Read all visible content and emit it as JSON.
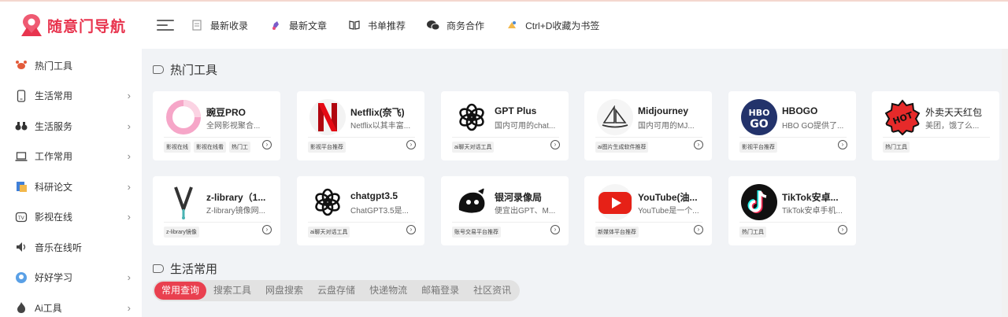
{
  "brand": {
    "name": "随意门导航",
    "color": "#e8344e"
  },
  "nav": [
    {
      "label": "最新收录",
      "icon": "document-icon"
    },
    {
      "label": "最新文章",
      "icon": "pen-icon"
    },
    {
      "label": "书单推荐",
      "icon": "book-icon"
    },
    {
      "label": "商务合作",
      "icon": "wechat-icon"
    },
    {
      "label": "Ctrl+D收藏为书签",
      "icon": "bookmark-icon"
    }
  ],
  "sidebar": [
    {
      "label": "热门工具",
      "icon": "crab-icon",
      "arrow": ""
    },
    {
      "label": "生活常用",
      "icon": "phone-icon",
      "arrow": "›"
    },
    {
      "label": "生活服务",
      "icon": "binoculars-icon",
      "arrow": "›"
    },
    {
      "label": "工作常用",
      "icon": "laptop-icon",
      "arrow": "›"
    },
    {
      "label": "科研论文",
      "icon": "paper-icon",
      "arrow": "›"
    },
    {
      "label": "影视在线",
      "icon": "tv-icon",
      "arrow": "›"
    },
    {
      "label": "音乐在线听",
      "icon": "speaker-icon",
      "arrow": ""
    },
    {
      "label": "好好学习",
      "icon": "study-icon",
      "arrow": "›"
    },
    {
      "label": "Ai工具",
      "icon": "fire-icon",
      "arrow": "›"
    }
  ],
  "sections": [
    {
      "title": "热门工具"
    },
    {
      "title": "生活常用"
    }
  ],
  "cards": [
    {
      "title": "豌豆PRO",
      "desc": "全网影视聚合...",
      "tags": [
        "影视在线",
        "影视在线看",
        "热门工"
      ],
      "icon": "wandou-pro-icon"
    },
    {
      "title": "Netflix(奈飞)",
      "desc": "Netflix以其丰富...",
      "tags": [
        "影视平台推荐"
      ],
      "icon": "netflix-icon"
    },
    {
      "title": "GPT Plus",
      "desc": "国内可用的chat...",
      "tags": [
        "ai聊天对话工具"
      ],
      "icon": "openai-icon"
    },
    {
      "title": "Midjourney",
      "desc": "国内可用的MJ...",
      "tags": [
        "ai图片生成软件推荐"
      ],
      "icon": "midjourney-icon"
    },
    {
      "title": "HBOGO",
      "desc": "HBO GO提供了...",
      "tags": [
        "影视平台推荐"
      ],
      "icon": "hbogo-icon"
    },
    {
      "title": "外卖天天红包",
      "desc": "美团，饿了么...",
      "tags": [
        "热门工具"
      ],
      "icon": "hot-badge-icon"
    },
    {
      "title": "z-library（1...",
      "desc": "Z-library镜像网...",
      "tags": [
        "z-library镜像"
      ],
      "icon": "zlibrary-icon"
    },
    {
      "title": "chatgpt3.5",
      "desc": "ChatGPT3.5是...",
      "tags": [
        "ai聊天对话工具"
      ],
      "icon": "openai-icon"
    },
    {
      "title": "银河录像局",
      "desc": "便宜出GPT、M...",
      "tags": [
        "账号交易平台推荐"
      ],
      "icon": "ghost-icon"
    },
    {
      "title": "YouTube(油...",
      "desc": "YouTube是一个...",
      "tags": [
        "新媒体平台推荐"
      ],
      "icon": "youtube-icon"
    },
    {
      "title": "TikTok安卓...",
      "desc": "TikTok安卓手机...",
      "tags": [
        "热门工具"
      ],
      "icon": "tiktok-icon"
    }
  ],
  "tabs": [
    "常用查询",
    "搜索工具",
    "网盘搜索",
    "云盘存储",
    "快递物流",
    "邮箱登录",
    "社区资讯"
  ],
  "active_tab": "常用查询",
  "accent": "#e9404f"
}
